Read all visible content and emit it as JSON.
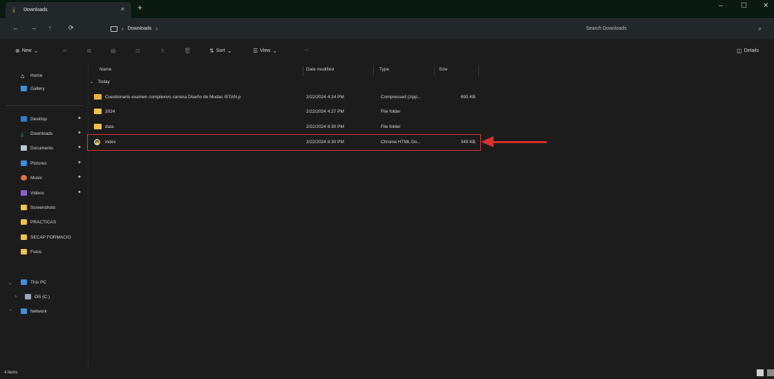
{
  "window": {
    "tab_title": "Downloads",
    "tab_close": "×",
    "new_tab": "+",
    "minimize": "–",
    "maximize": "☐",
    "close": "✕"
  },
  "navigation": {
    "back": "←",
    "forward": "→",
    "up": "↑",
    "refresh": "⟳",
    "breadcrumb_sep": "›",
    "breadcrumb": [
      "Downloads"
    ],
    "search_placeholder": "Search Downloads",
    "search_icon": "⌕"
  },
  "commands": {
    "new": "New",
    "sort": "Sort",
    "view": "View",
    "more": "···",
    "details": "Details"
  },
  "sidebar": {
    "items": [
      {
        "label": "Home",
        "icon": "home-icon",
        "color": "#ffffff"
      },
      {
        "label": "Gallery",
        "icon": "gallery-icon",
        "color": "#3f8fe0"
      },
      {
        "label": "Desktop",
        "icon": "desktop-icon",
        "color": "#2f7fd6",
        "pinned": true
      },
      {
        "label": "Downloads",
        "icon": "download-icon",
        "color": "#3aa65a",
        "pinned": true
      },
      {
        "label": "Documents",
        "icon": "documents-icon",
        "color": "#b9c6d6",
        "pinned": true
      },
      {
        "label": "Pictures",
        "icon": "pictures-icon",
        "color": "#3b8de0",
        "pinned": true
      },
      {
        "label": "Music",
        "icon": "music-icon",
        "color": "#e2743f",
        "pinned": true
      },
      {
        "label": "Videos",
        "icon": "videos-icon",
        "color": "#8c5cd6",
        "pinned": true
      },
      {
        "label": "Screenshots",
        "icon": "folder-icon",
        "color": "#f1c24a"
      },
      {
        "label": "PRACTICAS",
        "icon": "folder-icon",
        "color": "#f1c24a"
      },
      {
        "label": "SECAP FORMACIO",
        "icon": "folder-icon",
        "color": "#f1c24a"
      },
      {
        "label": "Fotos",
        "icon": "folder-icon",
        "color": "#f1c24a"
      }
    ],
    "tree": [
      {
        "label": "This PC",
        "icon": "pc-icon",
        "color": "#3f8fe0"
      },
      {
        "label": "OS (C:)",
        "icon": "drive-icon",
        "color": "#9aa7b6"
      },
      {
        "label": "Network",
        "icon": "network-icon",
        "color": "#3f8fe0"
      }
    ],
    "pin_glyph": "📌"
  },
  "file_list": {
    "columns": {
      "name": "Name",
      "date": "Date modified",
      "type": "Type",
      "size": "Size"
    },
    "group": "Today",
    "group_chevron": "⌄",
    "rows": [
      {
        "name": "Cuestionario examen complexivo carrera Diseño de Modas ISTAN.p",
        "date": "2/22/2024 4:24 PM",
        "type": "Compressed (zipp...",
        "size": "693 KB",
        "icon": "zip-icon"
      },
      {
        "name": "2024",
        "date": "2/22/2024 4:27 PM",
        "type": "File folder",
        "size": "",
        "icon": "folder-icon"
      },
      {
        "name": "data",
        "date": "2/22/2024 8:30 PM",
        "type": "File folder",
        "size": "",
        "icon": "folder-icon"
      },
      {
        "name": "index",
        "date": "2/22/2024 8:30 PM",
        "type": "Chrome HTML Do...",
        "size": "349 KB",
        "icon": "chrome-icon"
      }
    ]
  },
  "status": {
    "item_count": "4 items"
  },
  "colors": {
    "highlight_border": "#d73737",
    "arrow": "#d63131"
  }
}
